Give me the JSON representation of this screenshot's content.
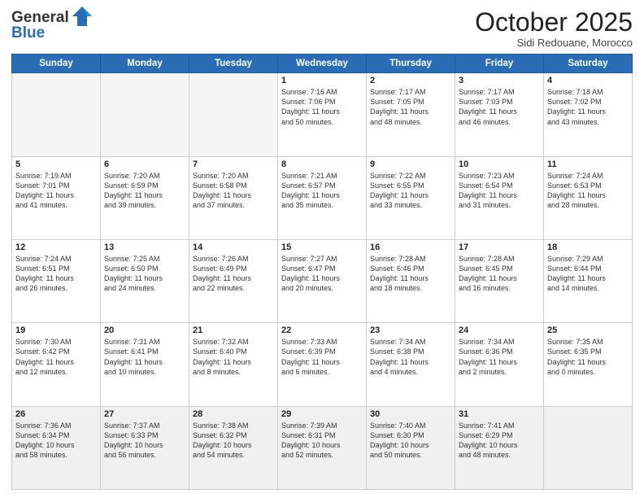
{
  "logo": {
    "line1": "General",
    "line2": "Blue"
  },
  "header": {
    "month": "October 2025",
    "location": "Sidi Redouane, Morocco"
  },
  "weekdays": [
    "Sunday",
    "Monday",
    "Tuesday",
    "Wednesday",
    "Thursday",
    "Friday",
    "Saturday"
  ],
  "weeks": [
    [
      {
        "day": "",
        "lines": []
      },
      {
        "day": "",
        "lines": []
      },
      {
        "day": "",
        "lines": []
      },
      {
        "day": "1",
        "lines": [
          "Sunrise: 7:16 AM",
          "Sunset: 7:06 PM",
          "Daylight: 11 hours",
          "and 50 minutes."
        ]
      },
      {
        "day": "2",
        "lines": [
          "Sunrise: 7:17 AM",
          "Sunset: 7:05 PM",
          "Daylight: 11 hours",
          "and 48 minutes."
        ]
      },
      {
        "day": "3",
        "lines": [
          "Sunrise: 7:17 AM",
          "Sunset: 7:03 PM",
          "Daylight: 11 hours",
          "and 46 minutes."
        ]
      },
      {
        "day": "4",
        "lines": [
          "Sunrise: 7:18 AM",
          "Sunset: 7:02 PM",
          "Daylight: 11 hours",
          "and 43 minutes."
        ]
      }
    ],
    [
      {
        "day": "5",
        "lines": [
          "Sunrise: 7:19 AM",
          "Sunset: 7:01 PM",
          "Daylight: 11 hours",
          "and 41 minutes."
        ]
      },
      {
        "day": "6",
        "lines": [
          "Sunrise: 7:20 AM",
          "Sunset: 6:59 PM",
          "Daylight: 11 hours",
          "and 39 minutes."
        ]
      },
      {
        "day": "7",
        "lines": [
          "Sunrise: 7:20 AM",
          "Sunset: 6:58 PM",
          "Daylight: 11 hours",
          "and 37 minutes."
        ]
      },
      {
        "day": "8",
        "lines": [
          "Sunrise: 7:21 AM",
          "Sunset: 6:57 PM",
          "Daylight: 11 hours",
          "and 35 minutes."
        ]
      },
      {
        "day": "9",
        "lines": [
          "Sunrise: 7:22 AM",
          "Sunset: 6:55 PM",
          "Daylight: 11 hours",
          "and 33 minutes."
        ]
      },
      {
        "day": "10",
        "lines": [
          "Sunrise: 7:23 AM",
          "Sunset: 6:54 PM",
          "Daylight: 11 hours",
          "and 31 minutes."
        ]
      },
      {
        "day": "11",
        "lines": [
          "Sunrise: 7:24 AM",
          "Sunset: 6:53 PM",
          "Daylight: 11 hours",
          "and 28 minutes."
        ]
      }
    ],
    [
      {
        "day": "12",
        "lines": [
          "Sunrise: 7:24 AM",
          "Sunset: 6:51 PM",
          "Daylight: 11 hours",
          "and 26 minutes."
        ]
      },
      {
        "day": "13",
        "lines": [
          "Sunrise: 7:25 AM",
          "Sunset: 6:50 PM",
          "Daylight: 11 hours",
          "and 24 minutes."
        ]
      },
      {
        "day": "14",
        "lines": [
          "Sunrise: 7:26 AM",
          "Sunset: 6:49 PM",
          "Daylight: 11 hours",
          "and 22 minutes."
        ]
      },
      {
        "day": "15",
        "lines": [
          "Sunrise: 7:27 AM",
          "Sunset: 6:47 PM",
          "Daylight: 11 hours",
          "and 20 minutes."
        ]
      },
      {
        "day": "16",
        "lines": [
          "Sunrise: 7:28 AM",
          "Sunset: 6:46 PM",
          "Daylight: 11 hours",
          "and 18 minutes."
        ]
      },
      {
        "day": "17",
        "lines": [
          "Sunrise: 7:28 AM",
          "Sunset: 6:45 PM",
          "Daylight: 11 hours",
          "and 16 minutes."
        ]
      },
      {
        "day": "18",
        "lines": [
          "Sunrise: 7:29 AM",
          "Sunset: 6:44 PM",
          "Daylight: 11 hours",
          "and 14 minutes."
        ]
      }
    ],
    [
      {
        "day": "19",
        "lines": [
          "Sunrise: 7:30 AM",
          "Sunset: 6:42 PM",
          "Daylight: 11 hours",
          "and 12 minutes."
        ]
      },
      {
        "day": "20",
        "lines": [
          "Sunrise: 7:31 AM",
          "Sunset: 6:41 PM",
          "Daylight: 11 hours",
          "and 10 minutes."
        ]
      },
      {
        "day": "21",
        "lines": [
          "Sunrise: 7:32 AM",
          "Sunset: 6:40 PM",
          "Daylight: 11 hours",
          "and 8 minutes."
        ]
      },
      {
        "day": "22",
        "lines": [
          "Sunrise: 7:33 AM",
          "Sunset: 6:39 PM",
          "Daylight: 11 hours",
          "and 6 minutes."
        ]
      },
      {
        "day": "23",
        "lines": [
          "Sunrise: 7:34 AM",
          "Sunset: 6:38 PM",
          "Daylight: 11 hours",
          "and 4 minutes."
        ]
      },
      {
        "day": "24",
        "lines": [
          "Sunrise: 7:34 AM",
          "Sunset: 6:36 PM",
          "Daylight: 11 hours",
          "and 2 minutes."
        ]
      },
      {
        "day": "25",
        "lines": [
          "Sunrise: 7:35 AM",
          "Sunset: 6:35 PM",
          "Daylight: 11 hours",
          "and 0 minutes."
        ]
      }
    ],
    [
      {
        "day": "26",
        "lines": [
          "Sunrise: 7:36 AM",
          "Sunset: 6:34 PM",
          "Daylight: 10 hours",
          "and 58 minutes."
        ]
      },
      {
        "day": "27",
        "lines": [
          "Sunrise: 7:37 AM",
          "Sunset: 6:33 PM",
          "Daylight: 10 hours",
          "and 56 minutes."
        ]
      },
      {
        "day": "28",
        "lines": [
          "Sunrise: 7:38 AM",
          "Sunset: 6:32 PM",
          "Daylight: 10 hours",
          "and 54 minutes."
        ]
      },
      {
        "day": "29",
        "lines": [
          "Sunrise: 7:39 AM",
          "Sunset: 6:31 PM",
          "Daylight: 10 hours",
          "and 52 minutes."
        ]
      },
      {
        "day": "30",
        "lines": [
          "Sunrise: 7:40 AM",
          "Sunset: 6:30 PM",
          "Daylight: 10 hours",
          "and 50 minutes."
        ]
      },
      {
        "day": "31",
        "lines": [
          "Sunrise: 7:41 AM",
          "Sunset: 6:29 PM",
          "Daylight: 10 hours",
          "and 48 minutes."
        ]
      },
      {
        "day": "",
        "lines": []
      }
    ]
  ]
}
